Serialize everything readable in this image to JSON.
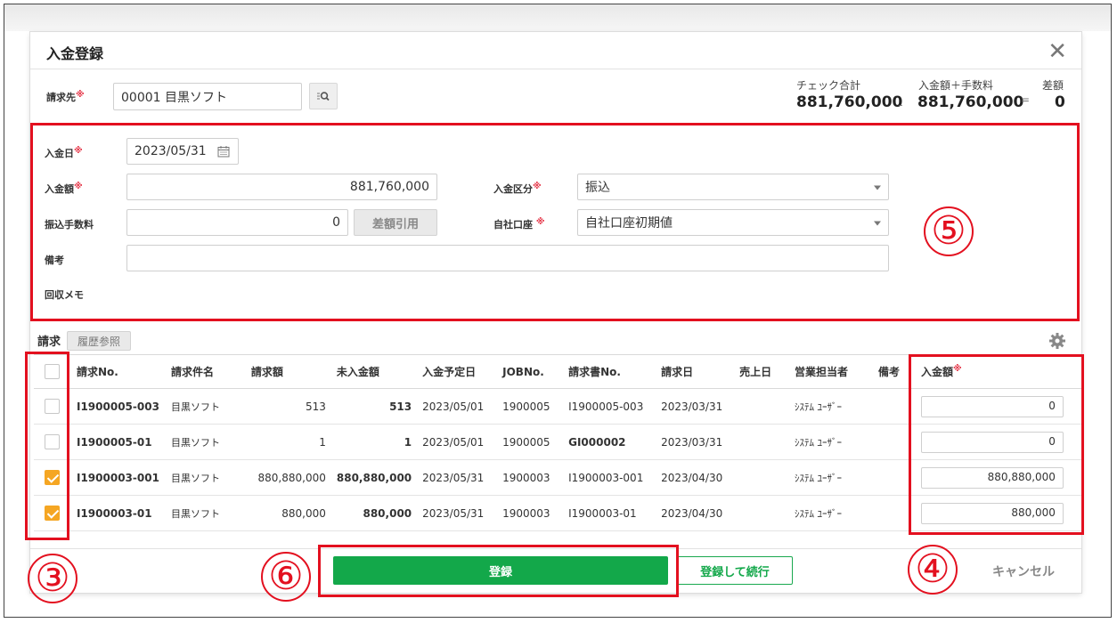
{
  "modal": {
    "title": "入金登録"
  },
  "billing": {
    "label": "請求先",
    "required_mark": "※",
    "value": "00001 目黒ソフト"
  },
  "summary": {
    "check_total_label": "チェック合計",
    "check_total_value": "881,760,000",
    "minus_op": "-",
    "deposit_fee_label": "入金額＋手数料",
    "deposit_fee_value": "881,760,000",
    "equals_op": "=",
    "diff_label": "差額",
    "diff_value": "0"
  },
  "form": {
    "date_label": "入金日",
    "date_value": "2023/05/31",
    "amount_label": "入金額",
    "amount_value": "881,760,000",
    "category_label": "入金区分",
    "category_value": "振込",
    "fee_label": "振込手数料",
    "fee_value": "0",
    "diff_button": "差額引用",
    "account_label": "自社口座",
    "account_value": "自社口座初期値",
    "note_label": "備考",
    "note_value": "",
    "memo_label": "回収メモ"
  },
  "invoice_section": {
    "title": "請求",
    "history_button": "履歴参照"
  },
  "table": {
    "headers": [
      "請求No.",
      "請求件名",
      "請求額",
      "未入金額",
      "入金予定日",
      "JOBNo.",
      "請求書No.",
      "請求日",
      "売上日",
      "営業担当者",
      "備考",
      "入金額"
    ],
    "rows": [
      {
        "checked": false,
        "no": "I1900005-003",
        "name": "目黒ソフト",
        "billed": "513",
        "unpaid": "513",
        "due": "2023/05/01",
        "job": "1900005",
        "invoice": "I1900005-003",
        "invoice_highlight": false,
        "date": "2023/03/31",
        "sales_date": "",
        "rep": "ｼｽﾃﾑ ﾕｰｻﾞｰ",
        "note": "",
        "amount": "0"
      },
      {
        "checked": false,
        "no": "I1900005-01",
        "name": "目黒ソフト",
        "billed": "1",
        "unpaid": "1",
        "due": "2023/05/01",
        "job": "1900005",
        "invoice": "GI000002",
        "invoice_highlight": true,
        "date": "2023/03/31",
        "sales_date": "",
        "rep": "ｼｽﾃﾑ ﾕｰｻﾞｰ",
        "note": "",
        "amount": "0"
      },
      {
        "checked": true,
        "no": "I1900003-001",
        "name": "目黒ソフト",
        "billed": "880,880,000",
        "unpaid": "880,880,000",
        "due": "2023/05/31",
        "job": "1900003",
        "invoice": "I1900003-001",
        "invoice_highlight": false,
        "date": "2023/04/30",
        "sales_date": "",
        "rep": "ｼｽﾃﾑ ﾕｰｻﾞｰ",
        "note": "",
        "amount": "880,880,000"
      },
      {
        "checked": true,
        "no": "I1900003-01",
        "name": "目黒ソフト",
        "billed": "880,000",
        "unpaid": "880,000",
        "due": "2023/05/31",
        "job": "1900003",
        "invoice": "I1900003-01",
        "invoice_highlight": false,
        "date": "2023/04/30",
        "sales_date": "",
        "rep": "ｼｽﾃﾑ ﾕｰｻﾞｰ",
        "note": "",
        "amount": "880,000"
      }
    ]
  },
  "footer": {
    "register_button": "登録",
    "register_continue_button": "登録して続行",
    "cancel_button": "キャンセル"
  },
  "annotations": [
    "⑤",
    "③",
    "⑥",
    "④"
  ],
  "colors": {
    "accent_green": "#13a84a",
    "accent_orange": "#e8860b",
    "annotation_red": "#e3101f"
  }
}
